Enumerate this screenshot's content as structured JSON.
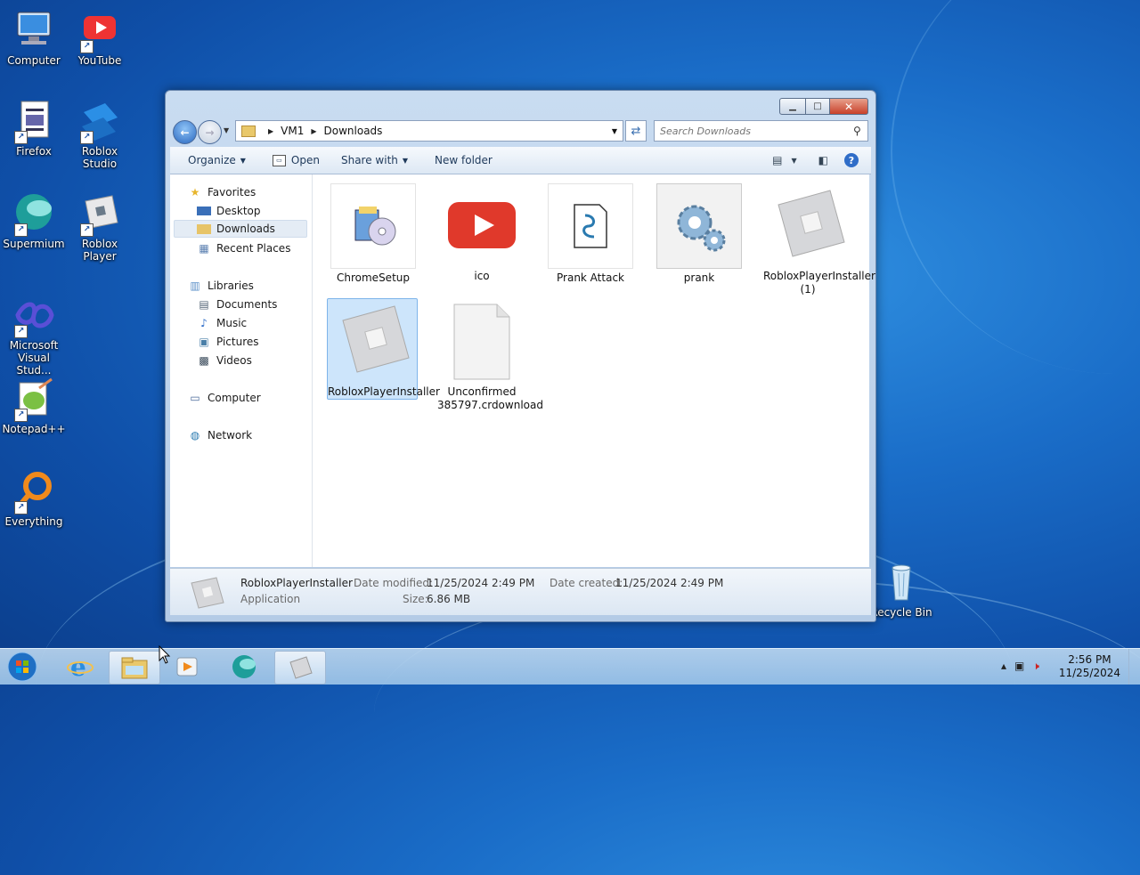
{
  "desktop": {
    "icons": [
      {
        "label": "Computer"
      },
      {
        "label": "YouTube"
      },
      {
        "label": "Firefox"
      },
      {
        "label": "Roblox Studio"
      },
      {
        "label": "Supermium"
      },
      {
        "label": "Roblox Player"
      },
      {
        "label": "Microsoft Visual Stud..."
      },
      {
        "label": "Notepad++"
      },
      {
        "label": "Everything"
      },
      {
        "label": "Recycle Bin"
      }
    ]
  },
  "window": {
    "breadcrumb": [
      "VM1",
      "Downloads"
    ],
    "search_placeholder": "Search Downloads",
    "toolbar": {
      "organize": "Organize",
      "open": "Open",
      "share_with": "Share with",
      "new_folder": "New folder"
    },
    "nav": {
      "favorites": "Favorites",
      "fav_items": [
        "Desktop",
        "Downloads",
        "Recent Places"
      ],
      "libraries": "Libraries",
      "lib_items": [
        "Documents",
        "Music",
        "Pictures",
        "Videos"
      ],
      "computer": "Computer",
      "network": "Network"
    },
    "files": [
      {
        "name": "ChromeSetup",
        "icon": "installer-cd-icon"
      },
      {
        "name": "ico",
        "icon": "youtube-play-icon"
      },
      {
        "name": "Prank Attack",
        "icon": "script-icon"
      },
      {
        "name": "prank",
        "icon": "gears-icon"
      },
      {
        "name": "RobloxPlayerInstaller (1)",
        "icon": "roblox-icon"
      },
      {
        "name": "RobloxPlayerInstaller",
        "icon": "roblox-icon",
        "selected": true
      },
      {
        "name": "Unconfirmed 385797.crdownload",
        "icon": "blank-file-icon"
      }
    ],
    "details": {
      "name": "RobloxPlayerInstaller",
      "type": "Application",
      "date_modified_label": "Date modified:",
      "date_modified": "11/25/2024 2:49 PM",
      "date_created_label": "Date created:",
      "date_created": "11/25/2024 2:49 PM",
      "size_label": "Size:",
      "size": "6.86 MB"
    }
  },
  "taskbar": {
    "time": "2:56 PM",
    "date": "11/25/2024"
  }
}
